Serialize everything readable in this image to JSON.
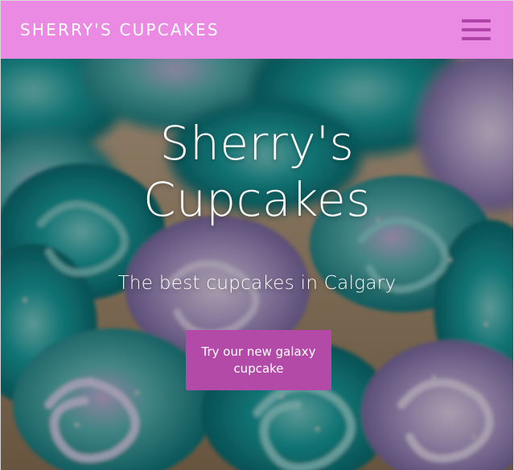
{
  "navbar": {
    "brand": "SHERRY'S CUPCAKES",
    "menu_icon": "hamburger-menu-icon",
    "background": "#ea8ae2",
    "icon_color": "#b144a8"
  },
  "hero": {
    "title": "Sherry's Cupcakes",
    "subtitle": "The best cupcakes in Calgary",
    "cta_label": "Try our new galaxy cupcake",
    "cta_color": "#b44aa8",
    "background_image": "teal-and-lavender-frosted-cupcakes-photo"
  }
}
